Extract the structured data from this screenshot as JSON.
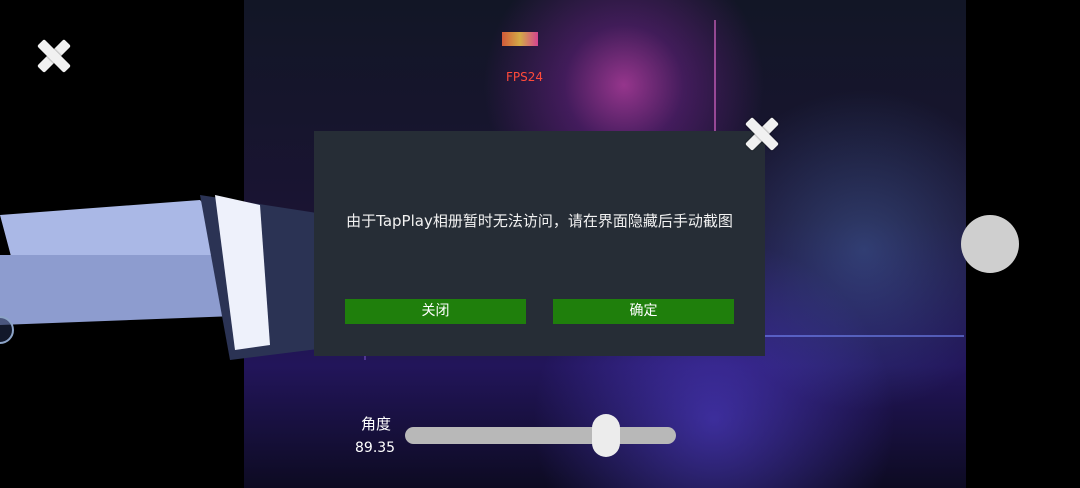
{
  "overlay": {
    "fps_label": "FPS24"
  },
  "dialog": {
    "message": "由于TapPlay相册暂时无法访问，请在界面隐藏后手动截图",
    "close_button_label": "关闭",
    "confirm_button_label": "确定",
    "button_color": "#1f7f0c",
    "background_color": "#262d36"
  },
  "angle_control": {
    "label": "角度",
    "value_text": "89.35",
    "slider_fraction": 0.74
  },
  "icons": {
    "top_left_close": "close-icon",
    "dialog_close": "close-icon",
    "right_action": "circle-button",
    "left_edge": "circle-icon"
  }
}
